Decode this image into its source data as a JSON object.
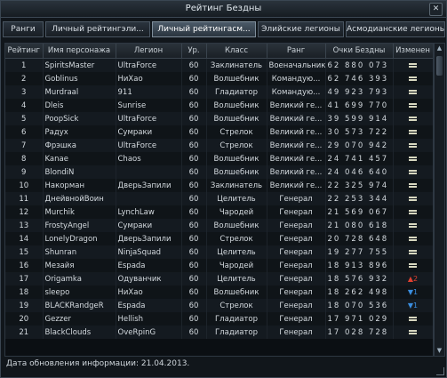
{
  "window": {
    "title": "Рейтинг Бездны",
    "close_label": "✕"
  },
  "tabs": [
    {
      "label": "Ранги",
      "active": false
    },
    {
      "label": "Личный рейтингэли...",
      "active": false
    },
    {
      "label": "Личный рейтингасм...",
      "active": true
    },
    {
      "label": "Элийские легионы",
      "active": false
    },
    {
      "label": "Асмодианские легионы",
      "active": false
    }
  ],
  "table": {
    "headers": [
      "Рейтинг",
      "Имя персонажа",
      "Легион",
      "Ур.",
      "Класс",
      "Ранг",
      "Очки Бездны",
      "Изменен"
    ],
    "rows": [
      {
        "rank": "1",
        "name": "SpiritsMaster",
        "legion": "UltraForce",
        "level": "60",
        "class": "Заклинатель",
        "grade": "Военачальник",
        "points": "62 880 073",
        "change": "="
      },
      {
        "rank": "2",
        "name": "Goblinus",
        "legion": "HиXao",
        "level": "60",
        "class": "Волшебник",
        "grade": "Командую...",
        "points": "62 746 393",
        "change": "="
      },
      {
        "rank": "3",
        "name": "Murdraal",
        "legion": "911",
        "level": "60",
        "class": "Гладиатор",
        "grade": "Командую...",
        "points": "49 923 793",
        "change": "="
      },
      {
        "rank": "4",
        "name": "Dleis",
        "legion": "Sunrise",
        "level": "60",
        "class": "Волшебник",
        "grade": "Великий ге...",
        "points": "41 699 770",
        "change": "="
      },
      {
        "rank": "5",
        "name": "PoopSick",
        "legion": "UltraForce",
        "level": "60",
        "class": "Волшебник",
        "grade": "Великий ге...",
        "points": "39 599 914",
        "change": "="
      },
      {
        "rank": "6",
        "name": "Радух",
        "legion": "Сумраки",
        "level": "60",
        "class": "Стрелок",
        "grade": "Великий ге...",
        "points": "30 573 722",
        "change": "="
      },
      {
        "rank": "7",
        "name": "Фрэшка",
        "legion": "UltraForce",
        "level": "60",
        "class": "Стрелок",
        "grade": "Великий ге...",
        "points": "29 070 942",
        "change": "="
      },
      {
        "rank": "8",
        "name": "Kanae",
        "legion": "Chaos",
        "level": "60",
        "class": "Волшебник",
        "grade": "Великий ге...",
        "points": "24 741 457",
        "change": "="
      },
      {
        "rank": "9",
        "name": "BlondiN",
        "legion": "",
        "level": "60",
        "class": "Волшебник",
        "grade": "Великий ге...",
        "points": "24 046 640",
        "change": "="
      },
      {
        "rank": "10",
        "name": "Накорман",
        "legion": "ДверьЗапили",
        "level": "60",
        "class": "Заклинатель",
        "grade": "Великий ге...",
        "points": "22 325 974",
        "change": "="
      },
      {
        "rank": "11",
        "name": "ДнейвнойВоин",
        "legion": "",
        "level": "60",
        "class": "Целитель",
        "grade": "Генерал",
        "points": "22 253 344",
        "change": "="
      },
      {
        "rank": "12",
        "name": "Murchik",
        "legion": "LynchLaw",
        "level": "60",
        "class": "Чародей",
        "grade": "Генерал",
        "points": "21 569 067",
        "change": "="
      },
      {
        "rank": "13",
        "name": "FrostyAngel",
        "legion": "Сумраки",
        "level": "60",
        "class": "Волшебник",
        "grade": "Генерал",
        "points": "21 080 618",
        "change": "="
      },
      {
        "rank": "14",
        "name": "LonelyDragon",
        "legion": "ДверьЗапили",
        "level": "60",
        "class": "Стрелок",
        "grade": "Генерал",
        "points": "20 728 648",
        "change": "="
      },
      {
        "rank": "15",
        "name": "Shunran",
        "legion": "NinjaSquad",
        "level": "60",
        "class": "Целитель",
        "grade": "Генерал",
        "points": "19 277 755",
        "change": "="
      },
      {
        "rank": "16",
        "name": "Мезайя",
        "legion": "Espada",
        "level": "60",
        "class": "Чародей",
        "grade": "Генерал",
        "points": "18 913 896",
        "change": "="
      },
      {
        "rank": "17",
        "name": "Origamka",
        "legion": "Одуванчик",
        "level": "60",
        "class": "Целитель",
        "grade": "Генерал",
        "points": "18 576 932",
        "change": "▲2"
      },
      {
        "rank": "18",
        "name": "sleepo",
        "legion": "HиXao",
        "level": "60",
        "class": "Волшебник",
        "grade": "Генерал",
        "points": "18 262 498",
        "change": "▼1"
      },
      {
        "rank": "19",
        "name": "BLACKRandgeR",
        "legion": "Espada",
        "level": "60",
        "class": "Стрелок",
        "grade": "Генерал",
        "points": "18 070 536",
        "change": "▼1"
      },
      {
        "rank": "20",
        "name": "Gezzer",
        "legion": "Hellish",
        "level": "60",
        "class": "Гладиатор",
        "grade": "Генерал",
        "points": "17 971 029",
        "change": "="
      },
      {
        "rank": "21",
        "name": "BlackClouds",
        "legion": "OveRpinG",
        "level": "60",
        "class": "Гладиатор",
        "grade": "Генерал",
        "points": "17 028 728",
        "change": "="
      }
    ]
  },
  "footer": {
    "text": "Дата обновления информации: 21.04.2013."
  },
  "colors": {
    "change_up": "#e04030",
    "change_down": "#3a8ee0",
    "change_same": "#d8d8c0"
  }
}
